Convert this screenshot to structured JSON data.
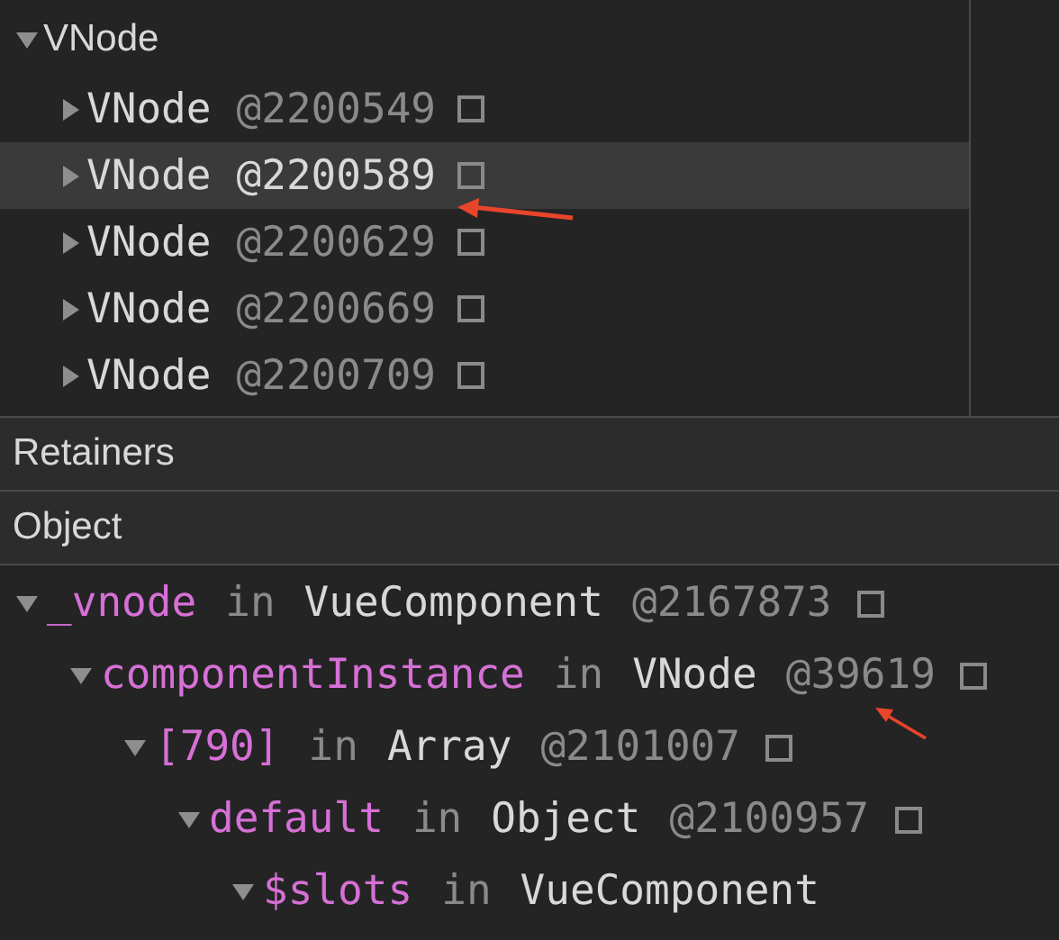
{
  "heap_tree": {
    "label": "VNode",
    "expanded": true,
    "children": [
      {
        "name": "VNode",
        "id": "@2200549",
        "selected": false,
        "expanded": false
      },
      {
        "name": "VNode",
        "id": "@2200589",
        "selected": true,
        "expanded": false
      },
      {
        "name": "VNode",
        "id": "@2200629",
        "selected": false,
        "expanded": false
      },
      {
        "name": "VNode",
        "id": "@2200669",
        "selected": false,
        "expanded": false
      },
      {
        "name": "VNode",
        "id": "@2200709",
        "selected": false,
        "expanded": false
      }
    ]
  },
  "sections": [
    "Retainers",
    "Object"
  ],
  "retainers": [
    {
      "name": "_vnode",
      "connector": "in",
      "type": "VueComponent",
      "id": "@2167873",
      "expanded": true,
      "children": [
        {
          "name": "componentInstance",
          "connector": "in",
          "type": "VNode",
          "id": "@39619",
          "expanded": true,
          "children": [
            {
              "name": "[790]",
              "connector": "in",
              "type": "Array",
              "id": "@2101007",
              "expanded": true,
              "children": [
                {
                  "name": "default",
                  "connector": "in",
                  "type": "Object",
                  "id": "@2100957",
                  "expanded": true,
                  "children": [
                    {
                      "name": "$slots",
                      "connector": "in",
                      "type": "VueComponent",
                      "expanded": true
                    }
                  ]
                }
              ]
            }
          ]
        }
      ]
    }
  ]
}
